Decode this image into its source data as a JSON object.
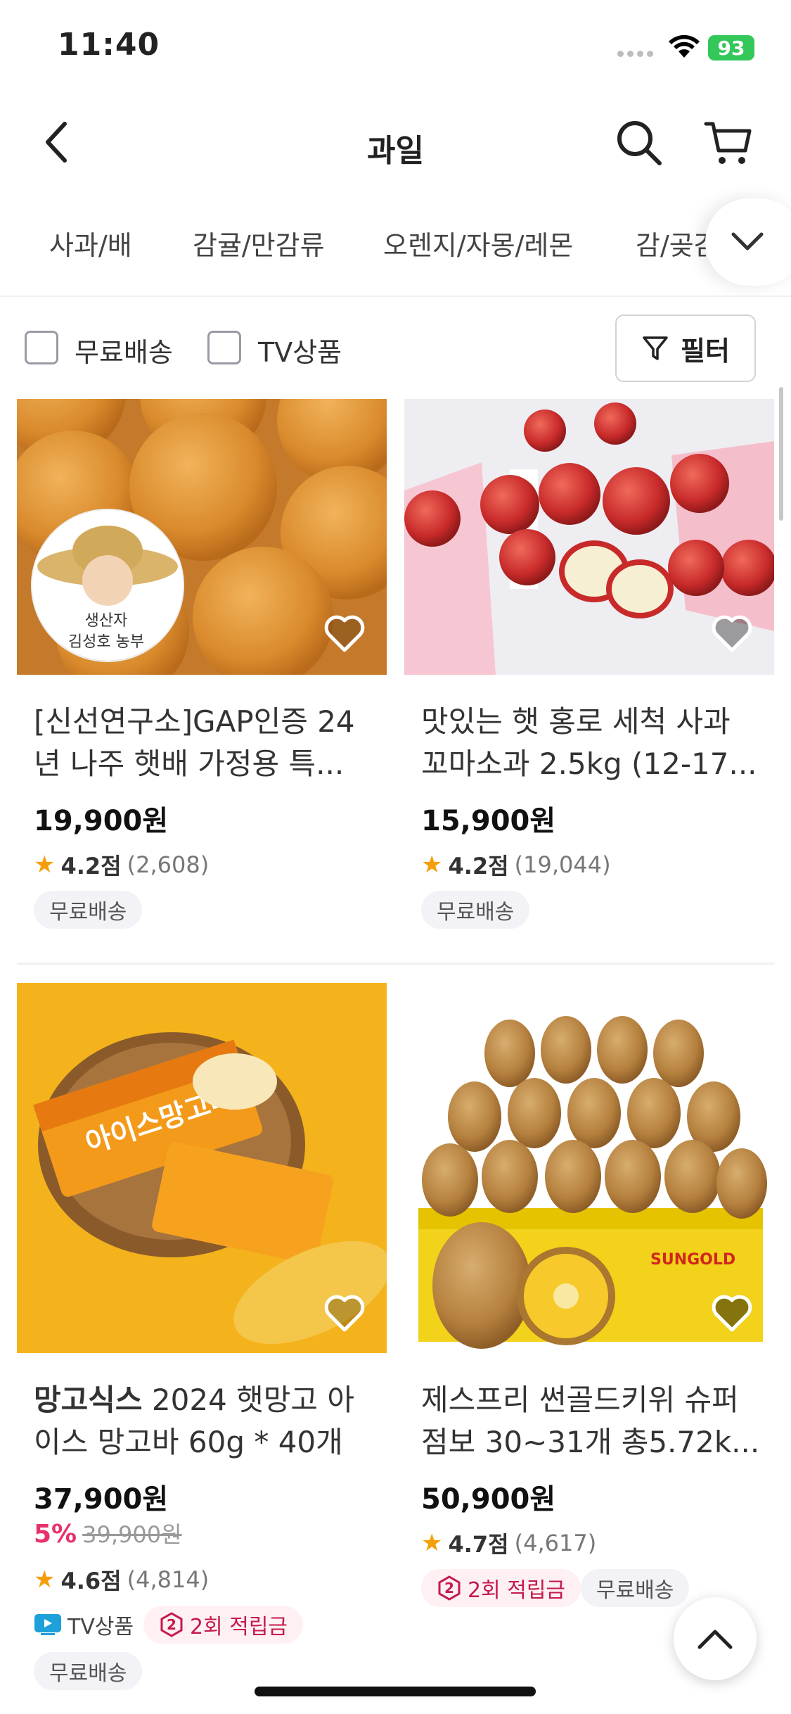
{
  "status_bar": {
    "time": "11:40",
    "battery": "93"
  },
  "header": {
    "title": "과일"
  },
  "categories": [
    "사과/배",
    "감귤/만감류",
    "오렌지/자몽/레몬",
    "감/곶감"
  ],
  "filters": {
    "free_shipping": "무료배송",
    "tv_product": "TV상품",
    "filter_button": "필터"
  },
  "products": [
    {
      "name": "[신선연구소]GAP인증 24년 나주 햇배 가정용 특...",
      "name_l1": "[신선연구소]GAP인증 24",
      "name_l2": "년 나주 햇배 가정용 특...",
      "producer_label": "생산자",
      "producer_name": "김성호 농부",
      "price": "19,900원",
      "rating": "4.2점",
      "review_count": "(2,608)",
      "tags": [
        "무료배송"
      ]
    },
    {
      "name": "맛있는 햇 홍로 세척 사과 꼬마소과 2.5kg (12-17...",
      "name_l1": "맛있는 햇 홍로 세척 사과",
      "name_l2": "꼬마소과 2.5kg (12-17...",
      "price": "15,900원",
      "rating": "4.2점",
      "review_count": "(19,044)",
      "tags": [
        "무료배송"
      ]
    },
    {
      "brand": "망고식스",
      "name_l1_rest": " 2024 햇망고 아",
      "name_l2": "이스 망고바 60g * 40개",
      "price": "37,900원",
      "discount": "5%",
      "original_price": "39,900원",
      "rating": "4.6점",
      "review_count": "(4,814)",
      "tags": [
        "TV상품",
        "2회 적립금",
        "무료배송"
      ],
      "reward_num": "2",
      "image_text": "아이스망고바"
    },
    {
      "name_l1": "제스프리 썬골드키위 슈퍼",
      "name_l2": "점보 30~31개 총5.72k...",
      "price": "50,900원",
      "rating": "4.7점",
      "review_count": "(4,617)",
      "tags": [
        "2회 적립금",
        "무료배송"
      ],
      "reward_num": "2",
      "image_text": "SUNGOLD"
    }
  ],
  "colors": {
    "accent_pink": "#e8316b",
    "star": "#f59e0b",
    "tv_blue": "#1ea0d8"
  }
}
